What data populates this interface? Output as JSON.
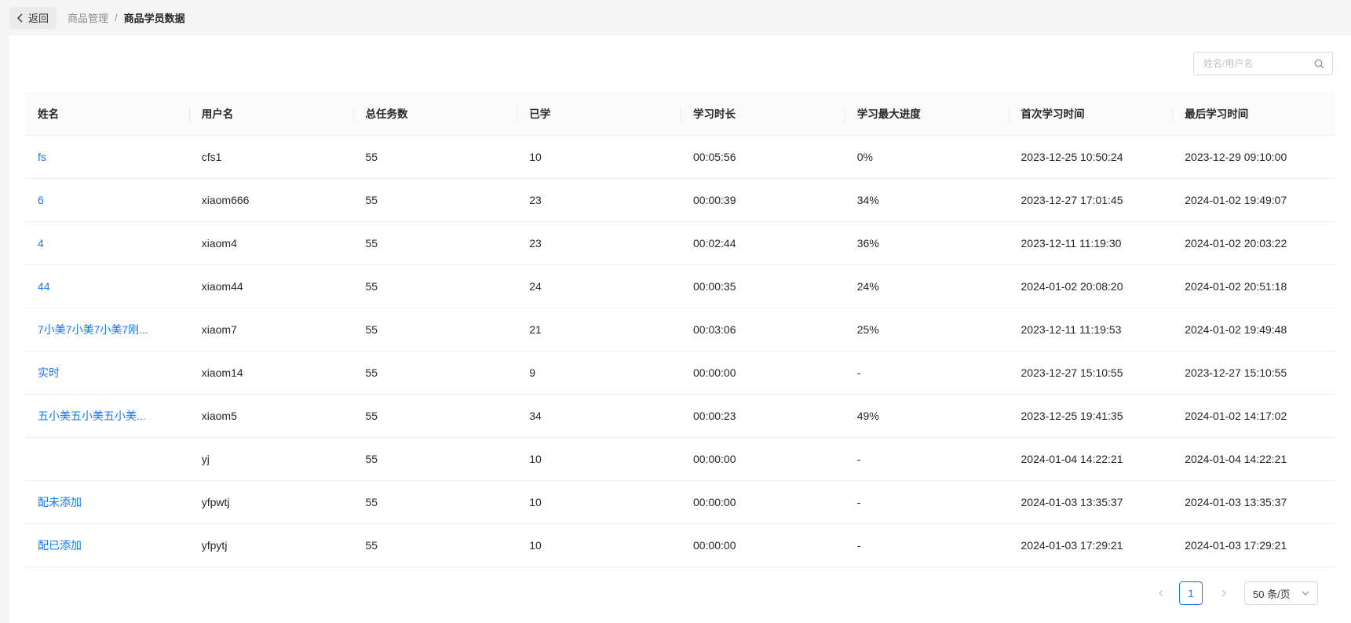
{
  "header": {
    "back_label": "返回",
    "breadcrumb_parent": "商品管理",
    "breadcrumb_sep": "/",
    "breadcrumb_current": "商品学员数据"
  },
  "search": {
    "placeholder": "姓名/用户名",
    "value": ""
  },
  "table": {
    "columns": [
      "姓名",
      "用户名",
      "总任务数",
      "已学",
      "学习时长",
      "学习最大进度",
      "首次学习时间",
      "最后学习时间"
    ],
    "rows": [
      {
        "name": "fs",
        "username": "cfs1",
        "total": "55",
        "learned": "10",
        "duration": "00:05:56",
        "progress": "0%",
        "first": "2023-12-25 10:50:24",
        "last": "2023-12-29 09:10:00"
      },
      {
        "name": "6",
        "username": "xiaom666",
        "total": "55",
        "learned": "23",
        "duration": "00:00:39",
        "progress": "34%",
        "first": "2023-12-27 17:01:45",
        "last": "2024-01-02 19:49:07"
      },
      {
        "name": "4",
        "username": "xiaom4",
        "total": "55",
        "learned": "23",
        "duration": "00:02:44",
        "progress": "36%",
        "first": "2023-12-11 11:19:30",
        "last": "2024-01-02 20:03:22"
      },
      {
        "name": "44",
        "username": "xiaom44",
        "total": "55",
        "learned": "24",
        "duration": "00:00:35",
        "progress": "24%",
        "first": "2024-01-02 20:08:20",
        "last": "2024-01-02 20:51:18"
      },
      {
        "name": "7小美7小美7小美7刚...",
        "username": "xiaom7",
        "total": "55",
        "learned": "21",
        "duration": "00:03:06",
        "progress": "25%",
        "first": "2023-12-11 11:19:53",
        "last": "2024-01-02 19:49:48"
      },
      {
        "name": "实时",
        "username": "xiaom14",
        "total": "55",
        "learned": "9",
        "duration": "00:00:00",
        "progress": "-",
        "first": "2023-12-27 15:10:55",
        "last": "2023-12-27 15:10:55"
      },
      {
        "name": "五小美五小美五小美...",
        "username": "xiaom5",
        "total": "55",
        "learned": "34",
        "duration": "00:00:23",
        "progress": "49%",
        "first": "2023-12-25 19:41:35",
        "last": "2024-01-02 14:17:02"
      },
      {
        "name": "",
        "username": "yj",
        "total": "55",
        "learned": "10",
        "duration": "00:00:00",
        "progress": "-",
        "first": "2024-01-04 14:22:21",
        "last": "2024-01-04 14:22:21"
      },
      {
        "name": "配未添加",
        "username": "yfpwtj",
        "total": "55",
        "learned": "10",
        "duration": "00:00:00",
        "progress": "-",
        "first": "2024-01-03 13:35:37",
        "last": "2024-01-03 13:35:37"
      },
      {
        "name": "配已添加",
        "username": "yfpytj",
        "total": "55",
        "learned": "10",
        "duration": "00:00:00",
        "progress": "-",
        "first": "2024-01-03 17:29:21",
        "last": "2024-01-03 17:29:21"
      }
    ]
  },
  "pagination": {
    "current_page": "1",
    "page_size_label": "50 条/页"
  },
  "colors": {
    "accent": "#1677ff",
    "header_bg": "#fafafa"
  },
  "icons": [
    "chevron-left-icon",
    "search-icon",
    "chevron-right-icon",
    "chevron-down-icon"
  ]
}
